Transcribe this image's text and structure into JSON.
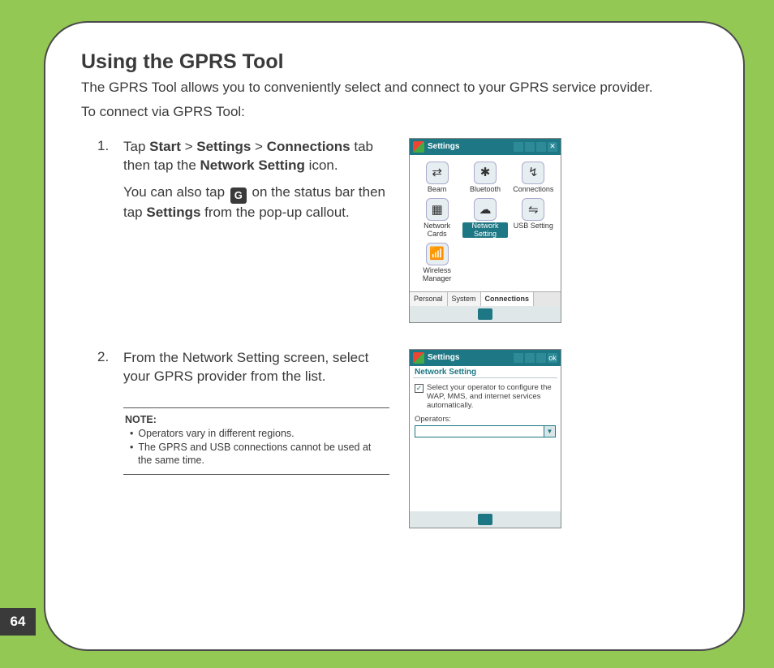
{
  "page_number": "64",
  "heading": "Using the GPRS Tool",
  "intro": "The GPRS Tool allows you to conveniently select and connect to your GPRS service provider.",
  "subintro": "To connect via GPRS Tool:",
  "step1": {
    "num": "1.",
    "tap": "Tap ",
    "start": "Start",
    "gt1": " > ",
    "settings": "Settings",
    "gt2": " > ",
    "connections": "Connections",
    "tail1": " tab then tap the ",
    "netset": "Network Setting",
    "tail1b": " icon.",
    "p2a": "You can also tap ",
    "gicon": "G",
    "p2b": " on the status bar then tap ",
    "settings2": "Settings",
    "p2c": " from the pop-up callout."
  },
  "step2": {
    "num": "2.",
    "text": "From the Network Setting screen, select your GPRS provider from the list."
  },
  "note": {
    "label": "NOTE:",
    "b1": "Operators vary in different regions.",
    "b2": "The GPRS and USB connections cannot be used at the same time."
  },
  "shot1": {
    "title": "Settings",
    "close": "✕",
    "items": [
      {
        "icon": "⇄",
        "label": "Beam"
      },
      {
        "icon": "✱",
        "label": "Bluetooth"
      },
      {
        "icon": "↯",
        "label": "Connections"
      },
      {
        "icon": "▦",
        "label": "Network Cards"
      },
      {
        "icon": "☁",
        "label": "Network Setting",
        "sel": true
      },
      {
        "icon": "⇋",
        "label": "USB Setting"
      },
      {
        "icon": "📶",
        "label": "Wireless Manager"
      }
    ],
    "tabs": [
      "Personal",
      "System",
      "Connections"
    ],
    "active_tab": 2
  },
  "shot2": {
    "title": "Settings",
    "ok": "ok",
    "subtitle": "Network Setting",
    "chk_text": "Select your operator to configure the WAP, MMS, and internet services automatically.",
    "op_label": "Operators:",
    "combo_caret": "▼"
  }
}
